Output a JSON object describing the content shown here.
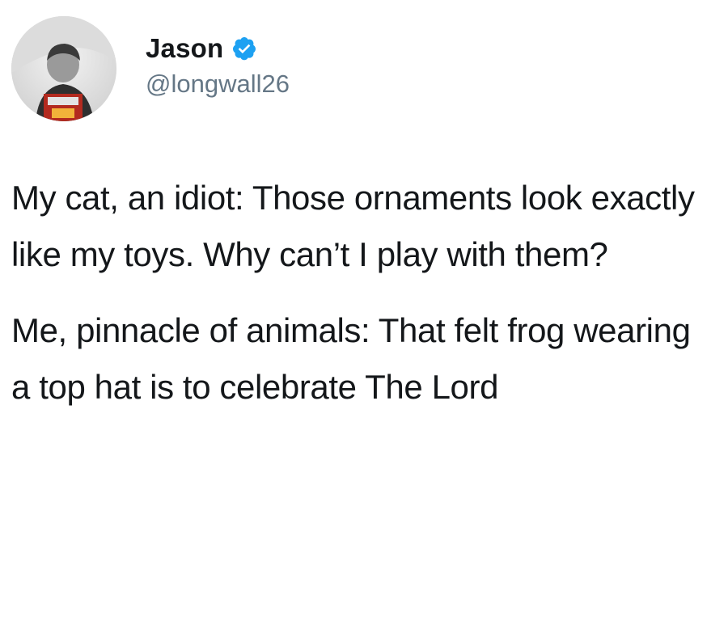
{
  "tweet": {
    "author": {
      "display_name": "Jason",
      "handle": "@longwall26",
      "verified": true,
      "avatar_icon": "user-avatar-photo",
      "verified_icon": "verified-badge-icon"
    },
    "paragraphs": [
      "My cat, an idiot: Those ornaments look exactly like my toys. Why can’t I play with them?",
      "Me, pinnacle of animals: That felt frog wearing a top hat is to celebrate The Lord"
    ]
  },
  "colors": {
    "text": "#14171a",
    "secondary_text": "#657786",
    "verified_blue": "#1da1f2",
    "background": "#ffffff"
  }
}
